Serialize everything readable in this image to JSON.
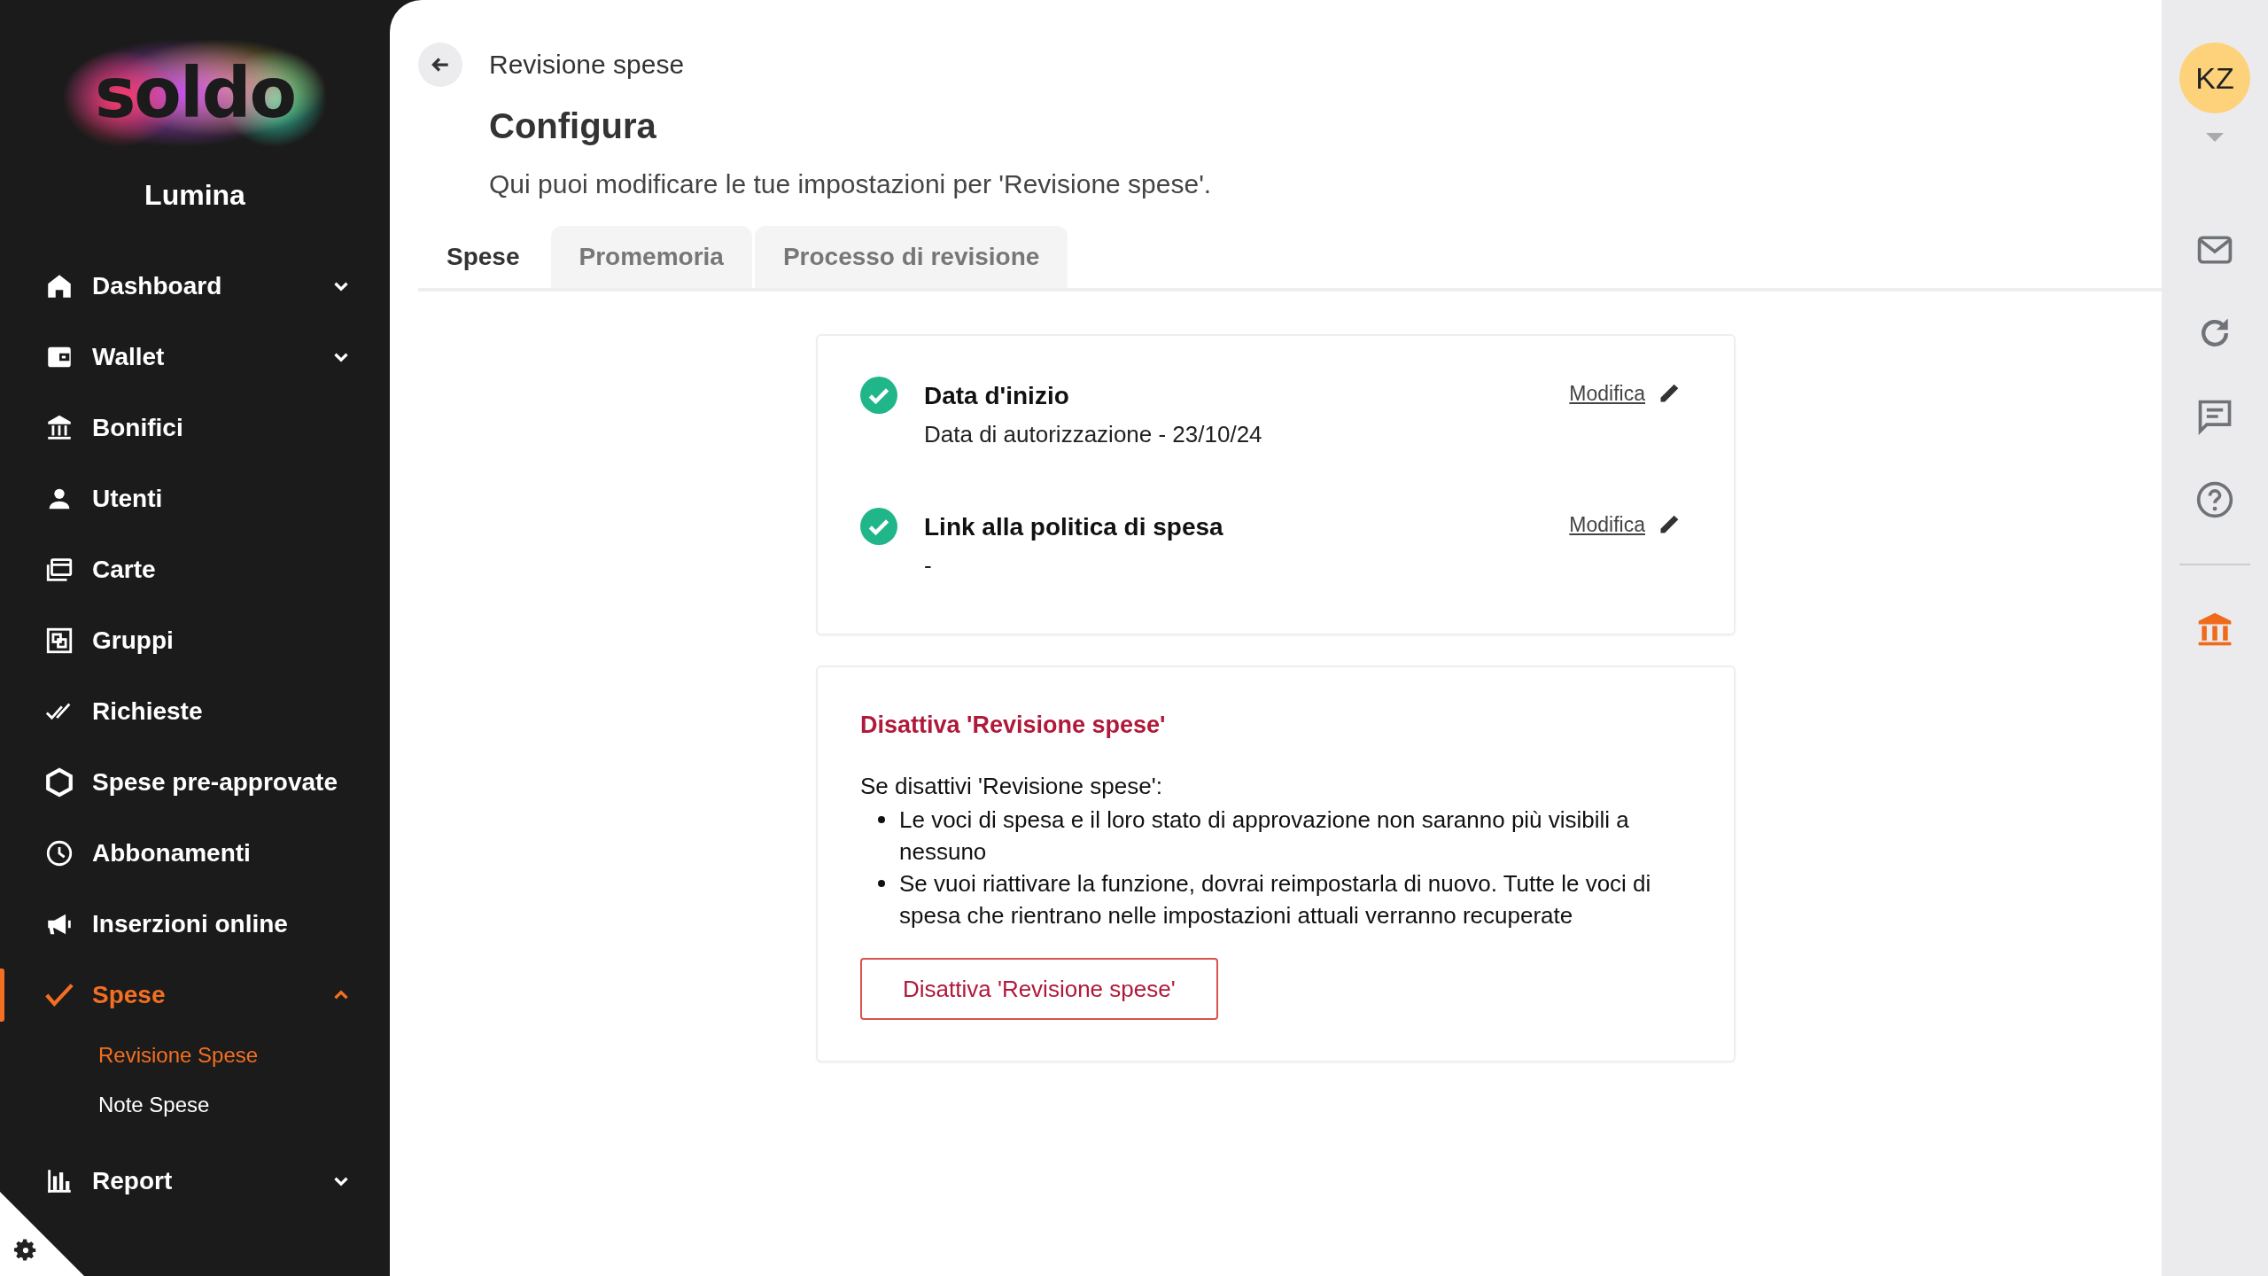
{
  "sidebar": {
    "logo": "soldo",
    "company": "Lumina",
    "items": [
      {
        "label": "Dashboard",
        "selected": false,
        "expanded": false
      },
      {
        "label": "Wallet",
        "selected": false,
        "expanded": false
      },
      {
        "label": "Bonifici",
        "selected": false
      },
      {
        "label": "Utenti",
        "selected": false
      },
      {
        "label": "Carte",
        "selected": false
      },
      {
        "label": "Gruppi",
        "selected": false
      },
      {
        "label": "Richieste",
        "selected": false
      },
      {
        "label": "Spese pre-approvate",
        "selected": false
      },
      {
        "label": "Abbonamenti",
        "selected": false
      },
      {
        "label": "Inserzioni online",
        "selected": false
      },
      {
        "label": "Spese",
        "selected": true,
        "expanded": true,
        "children": [
          {
            "label": "Revisione Spese",
            "selected": true
          },
          {
            "label": "Note Spese",
            "selected": false
          }
        ]
      },
      {
        "label": "Report",
        "selected": false,
        "expanded": false
      }
    ]
  },
  "header": {
    "breadcrumb": "Revisione spese",
    "title": "Configura",
    "description": "Qui puoi modificare le tue impostazioni per 'Revisione spese'."
  },
  "tabs": [
    {
      "label": "Spese",
      "selected": true
    },
    {
      "label": "Promemoria",
      "selected": false
    },
    {
      "label": "Processo di revisione",
      "selected": false
    }
  ],
  "settings": [
    {
      "title": "Data d'inizio",
      "value": "Data di autorizzazione - 23/10/24",
      "done": true,
      "action": "Modifica"
    },
    {
      "title": "Link alla politica di spesa",
      "value": "-",
      "done": true,
      "action": "Modifica"
    }
  ],
  "deactivate": {
    "title": "Disattiva 'Revisione spese'",
    "intro": "Se disattivi 'Revisione spese':",
    "bullets": [
      "Le voci di spesa e il loro stato di approvazione non saranno più visibili a nessuno",
      "Se vuoi riattivare la funzione, dovrai reimpostarla di nuovo. Tutte le voci di spesa che rientrano nelle impostazioni attuali verranno recuperate"
    ],
    "button": "Disattiva 'Revisione spese'"
  },
  "user": {
    "initials": "KZ"
  }
}
